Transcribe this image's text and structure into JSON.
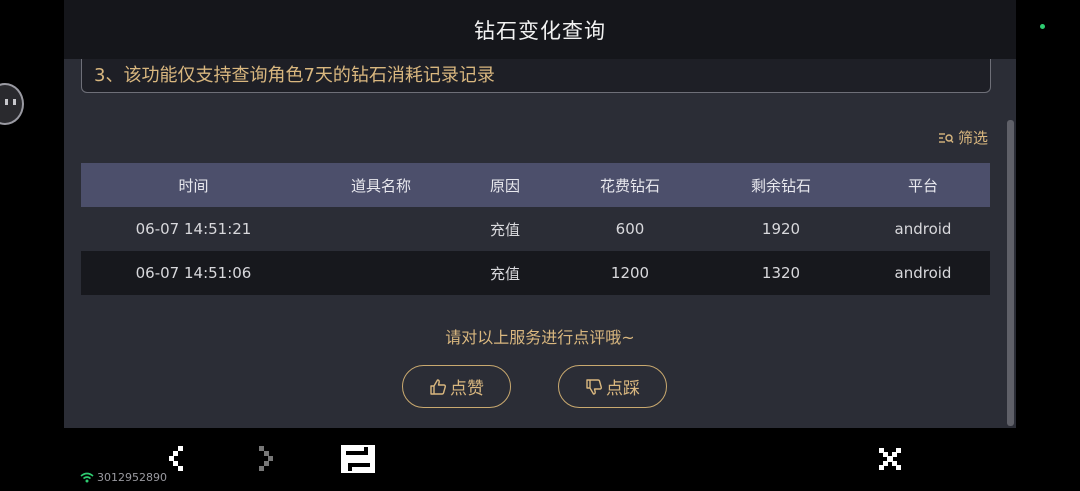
{
  "header": {
    "title": "钻石变化查询"
  },
  "notice": {
    "text": "3、该功能仅支持查询角色7天的钻石消耗记录记录"
  },
  "filter": {
    "label": "筛选",
    "icon": "filter-search-icon"
  },
  "table": {
    "columns": [
      "时间",
      "道具名称",
      "原因",
      "花费钻石",
      "剩余钻石",
      "平台"
    ],
    "rows": [
      [
        "06-07 14:51:21",
        "",
        "充值",
        "600",
        "1920",
        "android"
      ],
      [
        "06-07 14:51:06",
        "",
        "充值",
        "1200",
        "1320",
        "android"
      ]
    ]
  },
  "feedback": {
    "prompt": "请对以上服务进行点评哦~",
    "like_label": "点赞",
    "dislike_label": "点踩"
  },
  "bottom_nav": {
    "icons": [
      "back-icon",
      "forward-icon",
      "swap-icon",
      "close-icon"
    ]
  },
  "status": {
    "wifi_icon": "wifi-icon",
    "id_text": "3012952890"
  },
  "colors": {
    "accent": "#d9b77f",
    "header_row": "#4c4f6b",
    "panel": "#2b2d36",
    "title_bar": "#15161b"
  }
}
